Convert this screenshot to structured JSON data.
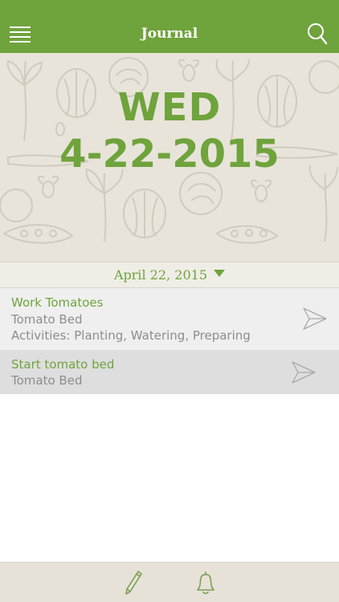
{
  "header": {
    "title": "Journal",
    "menu_icon": "hamburger-menu-icon",
    "search_icon": "search-icon",
    "background_color": "#6fa33c"
  },
  "hero": {
    "day_of_week": "WED",
    "date": "4-22-2015",
    "text_color": "#6fa33c",
    "background_color": "#e8e4da"
  },
  "date_selector": {
    "label": "April 22, 2015",
    "icon": "dropdown-triangle-icon"
  },
  "entries": [
    {
      "title": "Work Tomatoes",
      "bed": "Tomato Bed",
      "activities": "Activities: Planting, Watering, Preparing",
      "icon": "send-arrow-icon"
    },
    {
      "title": "Start tomato bed",
      "bed": "Tomato Bed",
      "icon": "send-arrow-icon"
    }
  ],
  "toolbar": {
    "pencil_icon": "pencil-icon",
    "bell_icon": "bell-icon"
  }
}
